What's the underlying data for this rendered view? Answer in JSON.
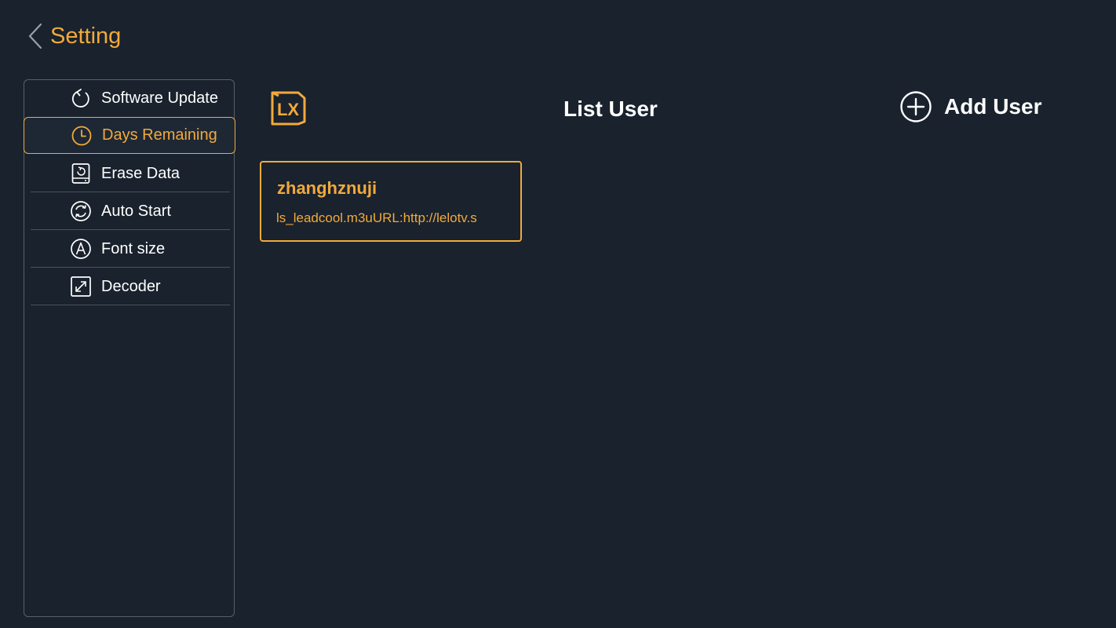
{
  "header": {
    "title": "Setting",
    "back_icon": "chevron-left-icon"
  },
  "colors": {
    "background": "#19222d",
    "accent": "#f2a93b",
    "text": "#ffffff",
    "border": "#59606a"
  },
  "sidebar": {
    "active_index": 1,
    "items": [
      {
        "label": "Software Update",
        "icon": "refresh-icon"
      },
      {
        "label": "Days Remaining",
        "icon": "clock-icon"
      },
      {
        "label": "Erase Data",
        "icon": "erase-data-icon"
      },
      {
        "label": "Auto Start",
        "icon": "auto-start-icon"
      },
      {
        "label": "Font size",
        "icon": "font-size-icon"
      },
      {
        "label": "Decoder",
        "icon": "decoder-icon"
      }
    ]
  },
  "main": {
    "logo": "LX",
    "title": "List User",
    "add_user_label": "Add User",
    "add_user_icon": "plus-circle-icon",
    "users": [
      {
        "name": "zhanghznuji",
        "url": "ls_leadcool.m3uURL:http://lelotv.s"
      }
    ]
  }
}
